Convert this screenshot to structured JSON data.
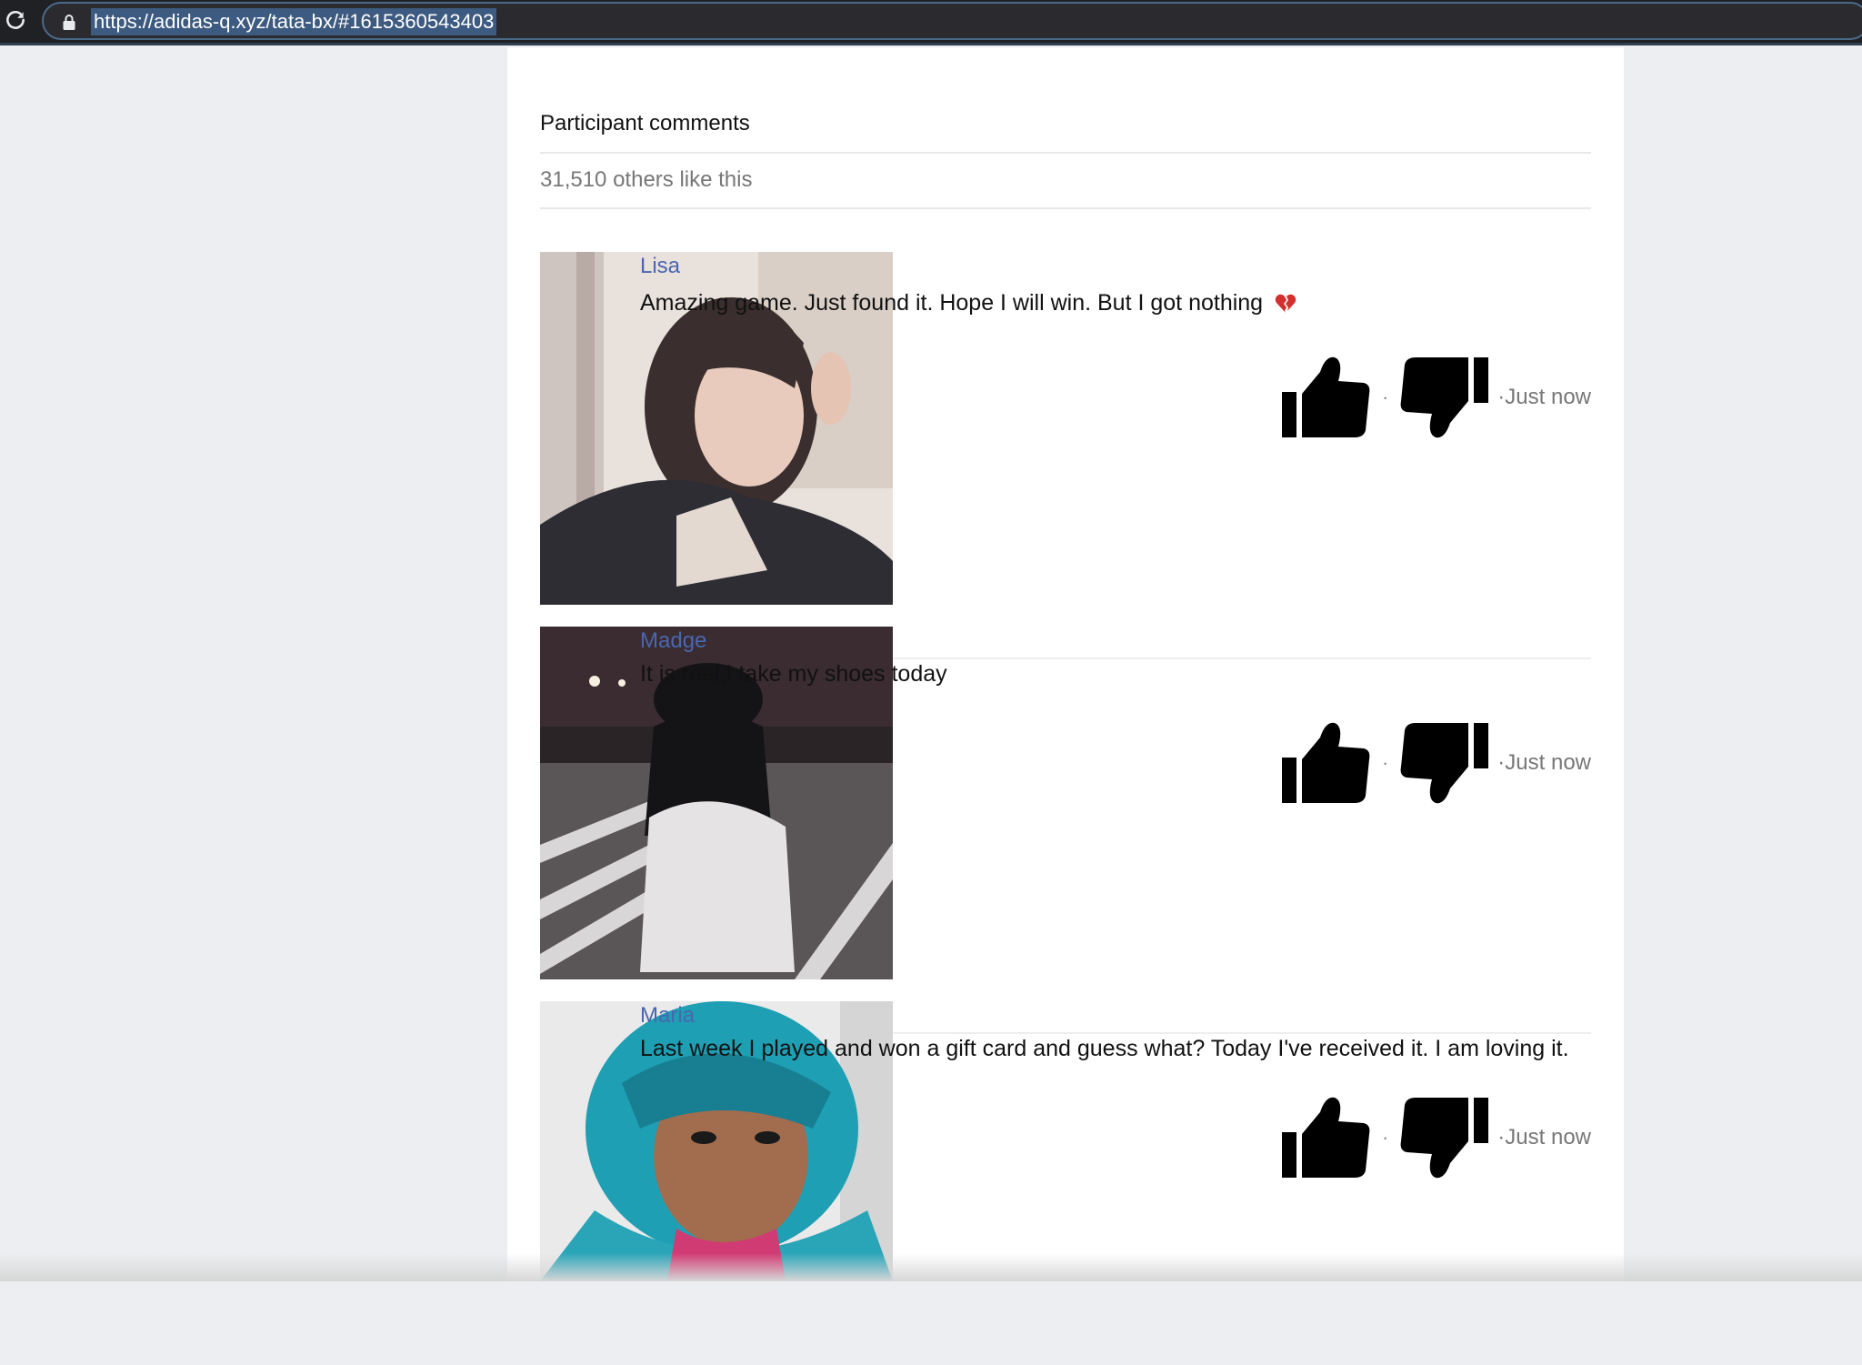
{
  "browser": {
    "url": "https://adidas-q.xyz/tata-bx/#1615360543403"
  },
  "section": {
    "title": "Participant comments",
    "likes_text": "31,510 others like this"
  },
  "comments": [
    {
      "name": "Lisa",
      "text": "Amazing game. Just found it. Hope I will win. But I got nothing",
      "emoji": "broken-heart-icon",
      "separator": "·",
      "time": "·Just now"
    },
    {
      "name": "Madge",
      "text": "It is real,I take my shoes today",
      "separator": "·",
      "time": "·Just now"
    },
    {
      "name": "Maria",
      "text": "Last week I played and won a gift card and guess what? Today I've received it. I am loving it.",
      "separator": "·",
      "time": "·Just now"
    }
  ],
  "colors": {
    "name_link": "#4a66b0",
    "page_bg": "#eceef1",
    "browser_bar": "#202124",
    "url_highlight": "#3d5a80"
  }
}
